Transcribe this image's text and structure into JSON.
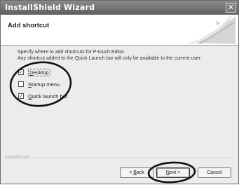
{
  "window": {
    "title": "InstallShield Wizard",
    "close_glyph": "✕"
  },
  "header": {
    "title": "Add shortcut"
  },
  "description": {
    "line1": "Specify where to add shortcuts for P-touch Editor.",
    "line2": "Any shortcut added to the Quick Launch bar will only be available to the current user."
  },
  "options": [
    {
      "pre": "",
      "u": "D",
      "post": "esktop",
      "checked": true
    },
    {
      "pre": "",
      "u": "S",
      "post": "tartup menu",
      "checked": false
    },
    {
      "pre": "",
      "u": "Q",
      "post": "uick launch bar",
      "checked": true
    }
  ],
  "footer": {
    "brand": "InstallShield"
  },
  "buttons": {
    "back": {
      "pre": "< ",
      "u": "B",
      "post": "ack"
    },
    "next": {
      "pre": "",
      "u": "N",
      "post": "ext >"
    },
    "cancel": "Cancel"
  },
  "check_glyph": "✓"
}
